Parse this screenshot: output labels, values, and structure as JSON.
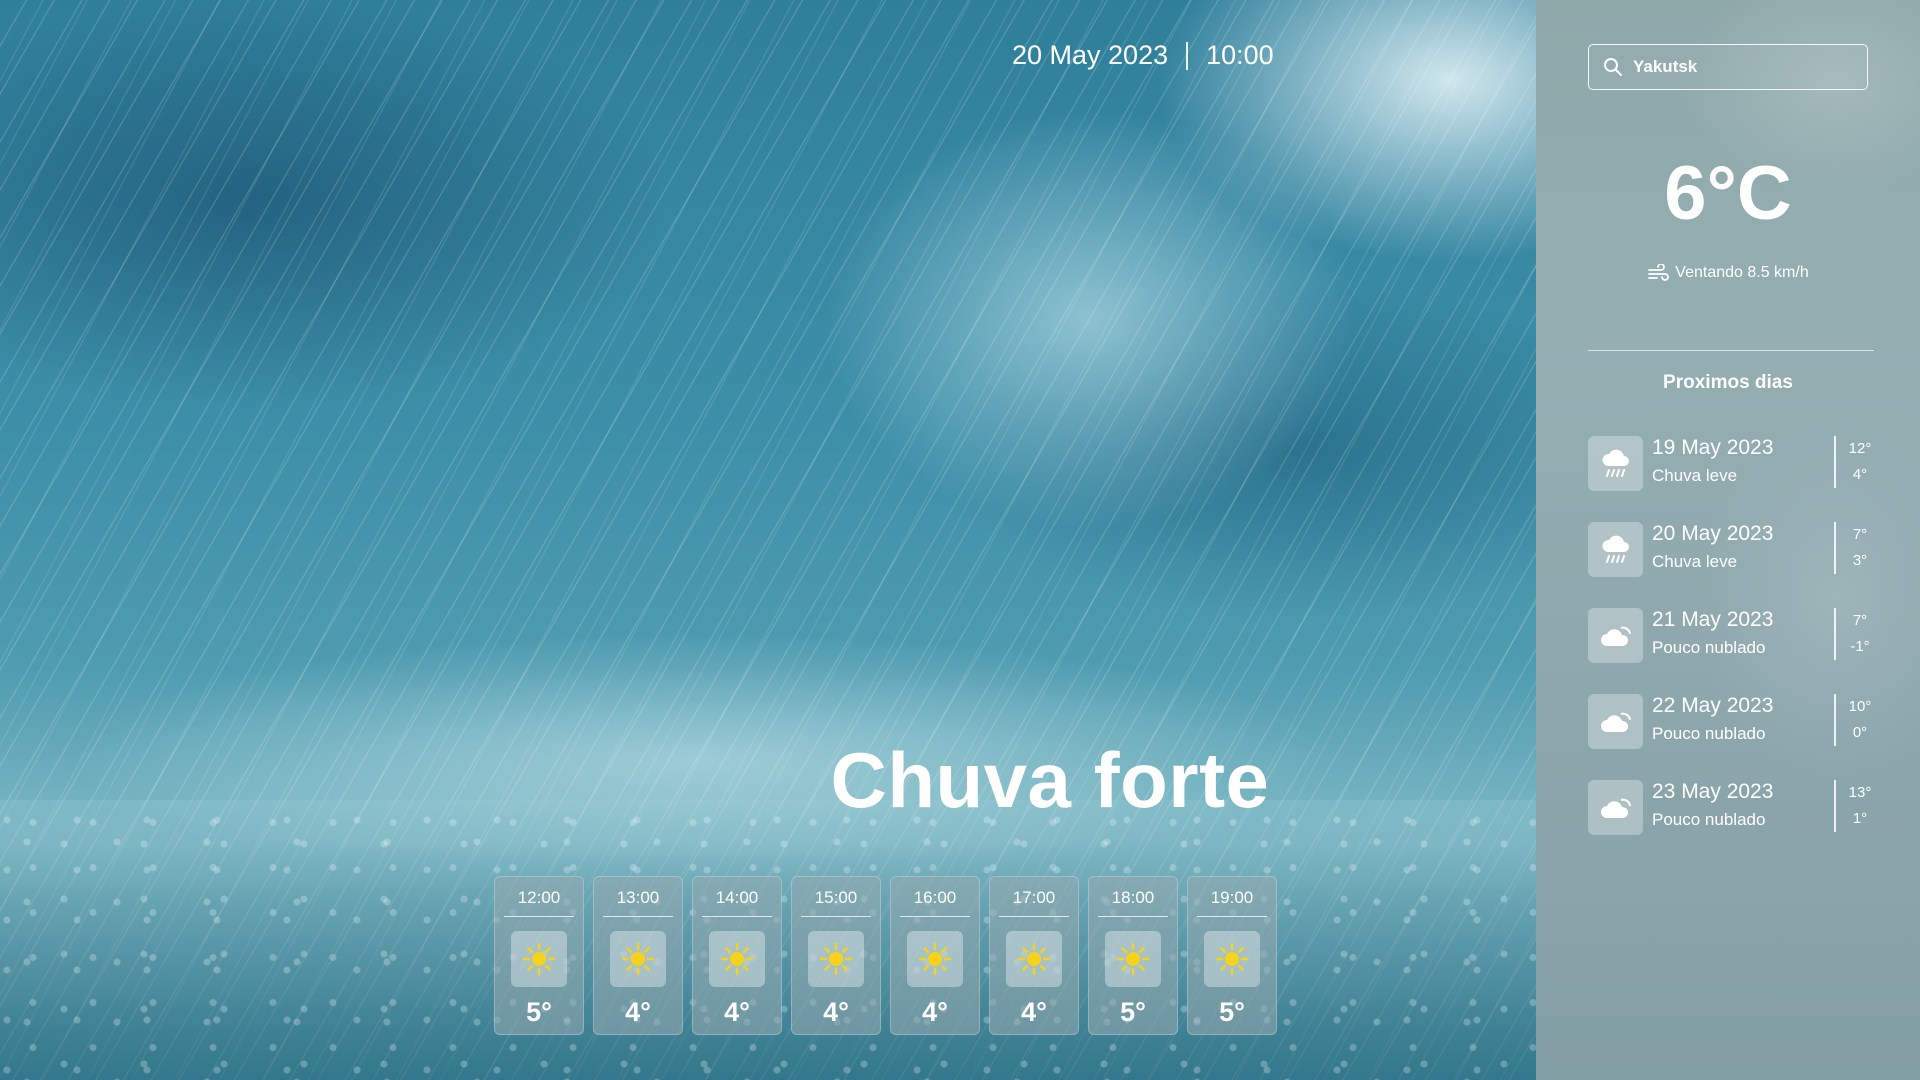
{
  "header": {
    "date": "20 May 2023",
    "time": "10:00"
  },
  "current": {
    "condition": "Chuva forte",
    "temperature": "6°C",
    "wind": "Ventando 8.5 km/h",
    "wind_icon": "wind-icon"
  },
  "search": {
    "value": "Yakutsk",
    "icon": "search-icon"
  },
  "hourly": [
    {
      "time": "12:00",
      "temp": "5°",
      "icon": "sun-icon"
    },
    {
      "time": "13:00",
      "temp": "4°",
      "icon": "sun-icon"
    },
    {
      "time": "14:00",
      "temp": "4°",
      "icon": "sun-icon"
    },
    {
      "time": "15:00",
      "temp": "4°",
      "icon": "sun-icon"
    },
    {
      "time": "16:00",
      "temp": "4°",
      "icon": "sun-icon"
    },
    {
      "time": "17:00",
      "temp": "4°",
      "icon": "sun-icon"
    },
    {
      "time": "18:00",
      "temp": "5°",
      "icon": "sun-icon"
    },
    {
      "time": "19:00",
      "temp": "5°",
      "icon": "sun-icon"
    }
  ],
  "next_days": {
    "title": "Proximos dias",
    "items": [
      {
        "date": "19 May 2023",
        "desc": "Chuva leve",
        "max": "12°",
        "min": "4°",
        "icon": "rain-cloud-icon"
      },
      {
        "date": "20 May 2023",
        "desc": "Chuva leve",
        "max": "7°",
        "min": "3°",
        "icon": "rain-cloud-icon"
      },
      {
        "date": "21 May 2023",
        "desc": "Pouco nublado",
        "max": "7°",
        "min": "-1°",
        "icon": "cloud-icon"
      },
      {
        "date": "22 May 2023",
        "desc": "Pouco nublado",
        "max": "10°",
        "min": "0°",
        "icon": "cloud-icon"
      },
      {
        "date": "23 May 2023",
        "desc": "Pouco nublado",
        "max": "13°",
        "min": "1°",
        "icon": "cloud-icon"
      }
    ]
  },
  "colors": {
    "sun": "#f7d21a",
    "text": "#ffffff",
    "panel": "#8fa8aa"
  }
}
